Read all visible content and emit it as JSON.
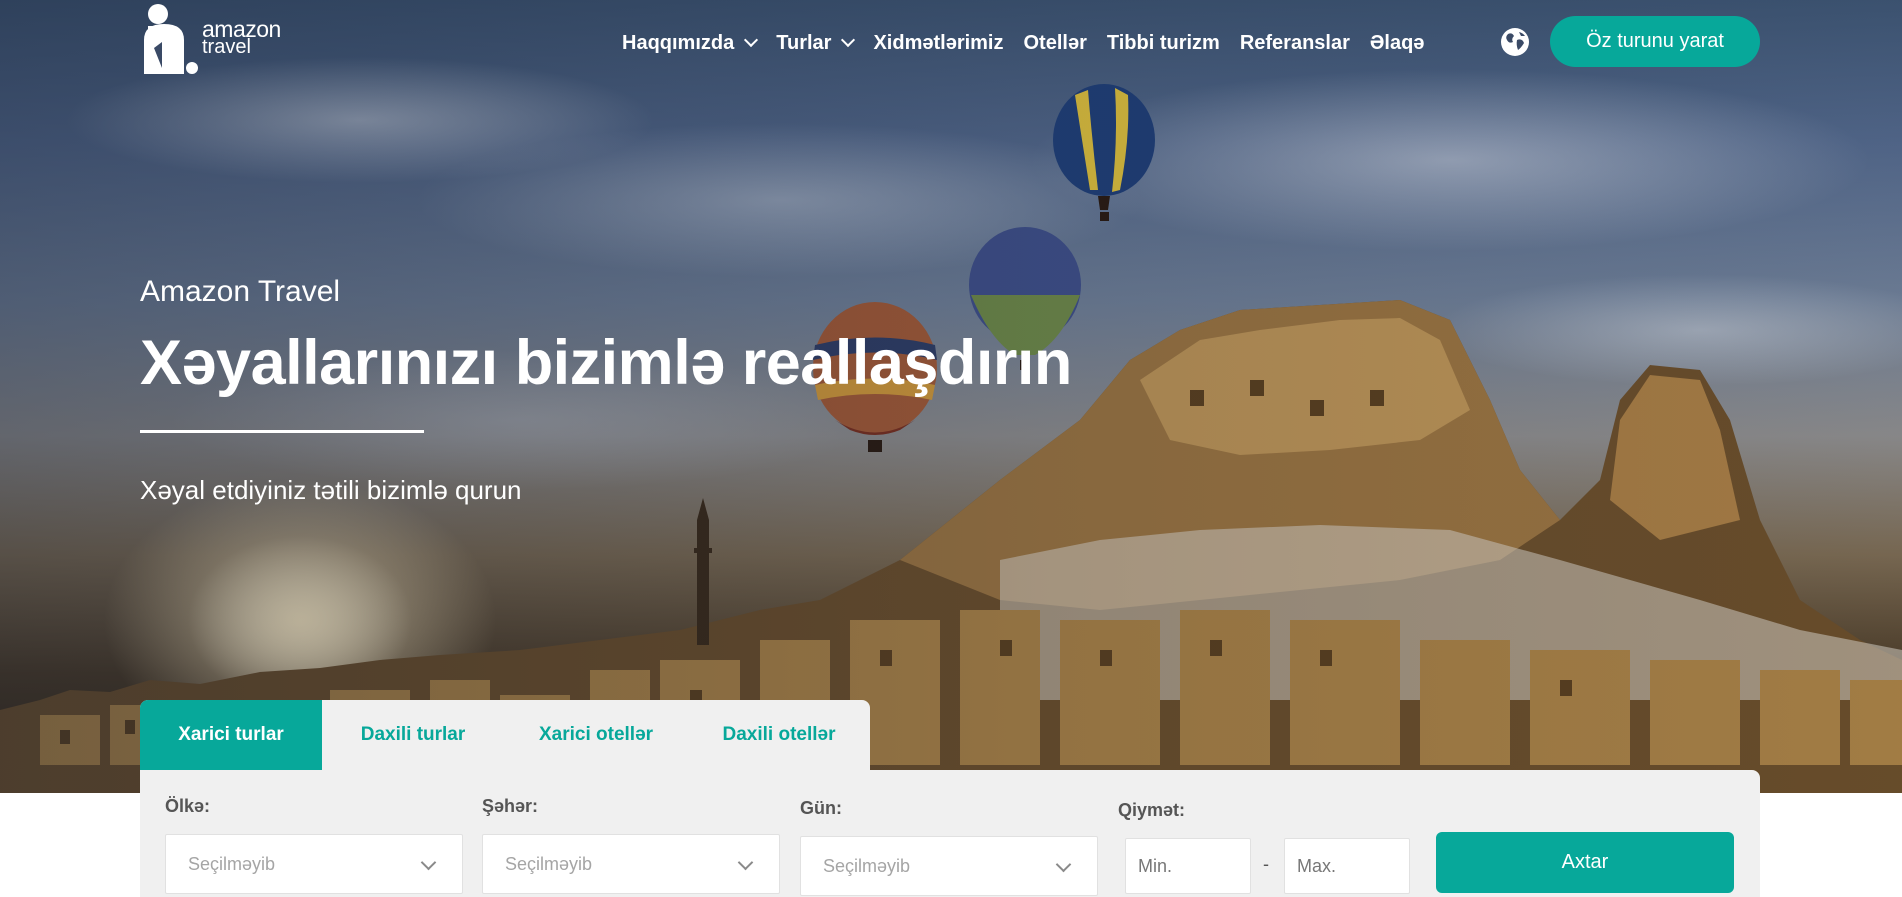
{
  "brand": {
    "name_line1": "amazon",
    "name_line2": "travel"
  },
  "nav": {
    "items": [
      {
        "label": "Haqqımızda",
        "dropdown": true
      },
      {
        "label": "Turlar",
        "dropdown": true
      },
      {
        "label": "Xidmətlərimiz",
        "dropdown": false
      },
      {
        "label": "Otellər",
        "dropdown": false
      },
      {
        "label": "Tibbi turizm",
        "dropdown": false
      },
      {
        "label": "Referanslar",
        "dropdown": false
      },
      {
        "label": "Əlaqə",
        "dropdown": false
      }
    ],
    "language_icon": "globe-icon",
    "cta_label": "Öz turunu yarat"
  },
  "hero": {
    "eyebrow": "Amazon Travel",
    "headline": "Xəyallarınızı bizimlə reallaşdırın",
    "subline": "Xəyal etdiyiniz tətili bizimlə qurun"
  },
  "search": {
    "tabs": [
      {
        "label": "Xarici turlar",
        "active": true
      },
      {
        "label": "Daxili turlar",
        "active": false
      },
      {
        "label": "Xarici otellər",
        "active": false
      },
      {
        "label": "Daxili otellər",
        "active": false
      }
    ],
    "fields": {
      "country": {
        "label": "Ölkə:",
        "value": "Seçilməyib"
      },
      "city": {
        "label": "Şəhər:",
        "value": "Seçilməyib"
      },
      "day": {
        "label": "Gün:",
        "value": "Seçilməyib"
      },
      "price": {
        "label": "Qiymət:",
        "min_placeholder": "Min.",
        "max_placeholder": "Max.",
        "separator": "-"
      }
    },
    "submit_label": "Axtar"
  },
  "colors": {
    "accent": "#07a89a",
    "panel_bg": "#f0f0f0",
    "text_white": "#ffffff"
  }
}
